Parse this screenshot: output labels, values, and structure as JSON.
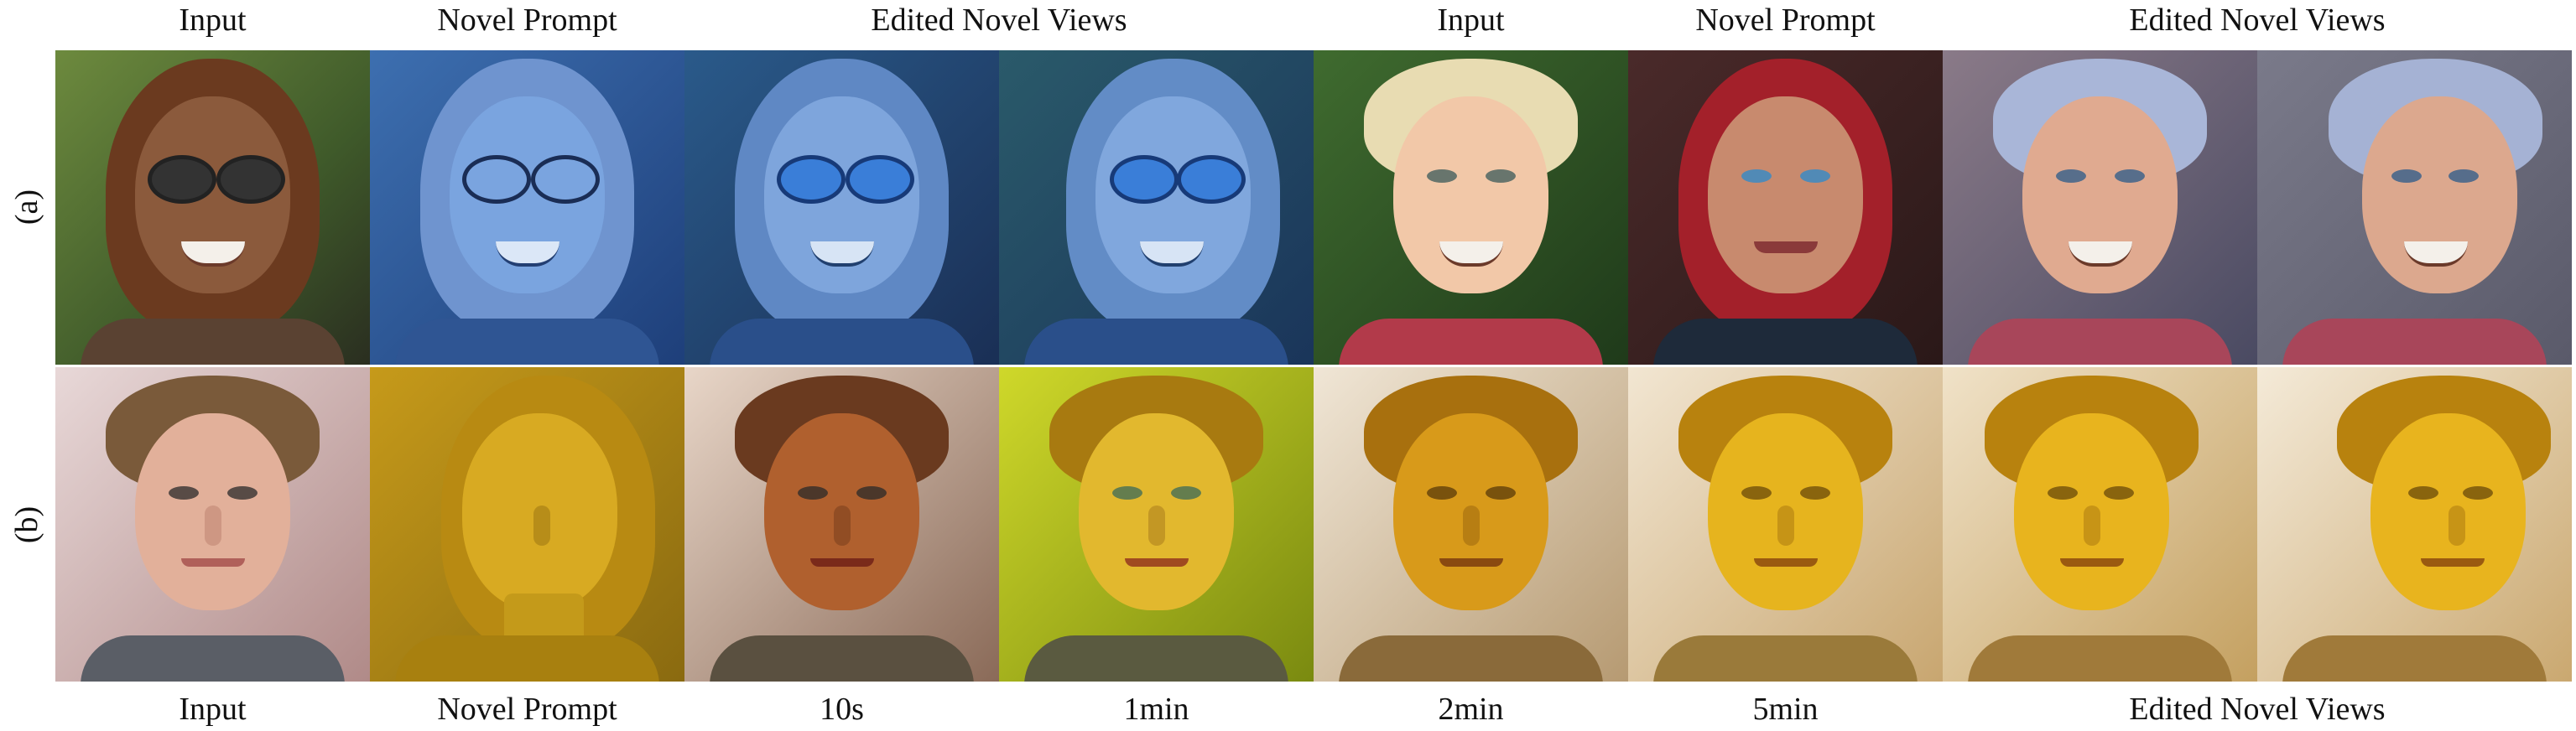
{
  "header": {
    "input_left": "Input",
    "novel_prompt_left": "Novel Prompt",
    "edited_left": "Edited Novel Views",
    "input_right": "Input",
    "novel_prompt_right": "Novel Prompt",
    "edited_right": "Edited Novel Views"
  },
  "rows": {
    "a": "(a)",
    "b": "(b)"
  },
  "footer": {
    "input": "Input",
    "novel_prompt": "Novel Prompt",
    "t1": "10s",
    "t2": "1min",
    "t3": "2min",
    "t4": "5min",
    "edited": "Edited Novel Views"
  }
}
